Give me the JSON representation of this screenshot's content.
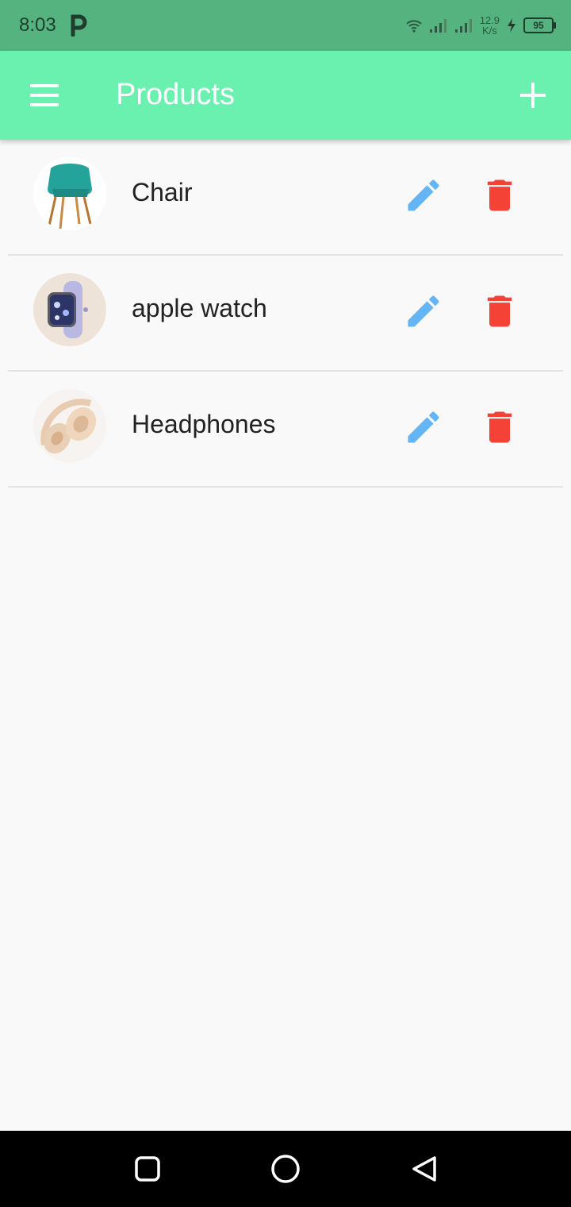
{
  "status_bar": {
    "time": "8:03",
    "speed_value": "12.9",
    "speed_unit": "K/s",
    "battery": "95"
  },
  "app_bar": {
    "title": "Products",
    "menu_icon": "hamburger-menu-icon",
    "add_icon": "plus-icon",
    "color": "#6af1b0"
  },
  "products": [
    {
      "name": "Chair",
      "image": "teal-chair-photo"
    },
    {
      "name": "apple watch",
      "image": "apple-watch-photo"
    },
    {
      "name": "Headphones",
      "image": "beige-headphones-photo"
    }
  ],
  "icons": {
    "edit": "pencil-icon",
    "delete": "trash-icon",
    "edit_color": "#64b5f6",
    "delete_color": "#f44336"
  },
  "nav_bar": {
    "recent": "square-icon",
    "home": "circle-icon",
    "back": "triangle-back-icon"
  }
}
